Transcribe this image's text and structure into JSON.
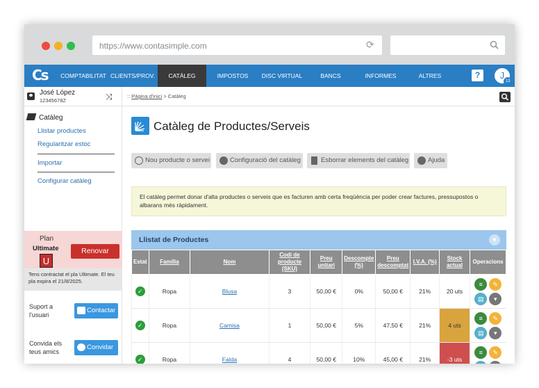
{
  "browser": {
    "url": "https://www.contasimple.com"
  },
  "nav": {
    "logo": "Cs",
    "items": [
      "COMPTABILITAT",
      "CLIENTS/PROV.",
      "CATÀLEG",
      "IMPOSTOS",
      "DISC VIRTUAL",
      "BANCS",
      "INFORMES",
      "ALTRES"
    ],
    "active": "CATÀLEG",
    "help": "?",
    "avatar_initial": "J",
    "avatar_badge": "13"
  },
  "user": {
    "name": "José López",
    "nif": "12345678Z"
  },
  "sidebar": {
    "section_title": "Catàleg",
    "links": [
      "Llistar productes",
      "Regularitzar estoc",
      "Importar",
      "Configurar catàleg"
    ]
  },
  "plan": {
    "label": "Plan",
    "name": "Ultimate",
    "badge": "U",
    "renew_label": "Renovar",
    "info": "Tens contractat el pla Ultimate. El teu pla expira el 21/8/2025."
  },
  "support": {
    "label": "Suport a l'usuari",
    "button": "Contactar"
  },
  "invite": {
    "label": "Convida els teus amics",
    "button": "Convidar"
  },
  "breadcrumb": {
    "prefix": "::",
    "home": "Pàgina d'inici",
    "current": "> Catàleg"
  },
  "page": {
    "title": "Catàleg de Productes/Serveis"
  },
  "toolbar": {
    "new": "Nou producte o servei",
    "config": "Configuració del catàleg",
    "delete": "Esborrar elements del catàleg",
    "help": "Ajuda"
  },
  "info": "El catàleg permet donar d'alta productes o serveis que es facturen amb certa freqüència per poder crear factures, pressupostos o albarans més ràpidament.",
  "list": {
    "title": "Llistat de Productes",
    "columns": [
      "Estat",
      "Família",
      "Nom",
      "Codi de producte (SKU)",
      "Preu unitari",
      "Descompte (%)",
      "Preu descomptat",
      "I.V.A. (%)",
      "Stock actual",
      "Operacions"
    ],
    "rows": [
      {
        "familia": "Ropa",
        "nom": "Blusa",
        "sku": "3",
        "preu": "50,00 €",
        "descompte": "0%",
        "preu_desc": "50,00 €",
        "iva": "21%",
        "stock": "20 uts",
        "stock_level": "ok"
      },
      {
        "familia": "Ropa",
        "nom": "Camisa",
        "sku": "1",
        "preu": "50,00 €",
        "descompte": "5%",
        "preu_desc": "47,50 €",
        "iva": "21%",
        "stock": "4 uts",
        "stock_level": "warn"
      },
      {
        "familia": "Ropa",
        "nom": "Falda",
        "sku": "4",
        "preu": "50,00 €",
        "descompte": "10%",
        "preu_desc": "45,00 €",
        "iva": "21%",
        "stock": "-3 uts",
        "stock_level": "bad"
      }
    ]
  }
}
